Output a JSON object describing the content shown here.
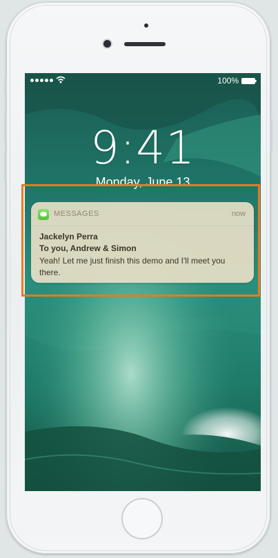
{
  "status_bar": {
    "signal_bars": 5,
    "battery_percent": "100%",
    "icons": [
      "signal-dots-icon",
      "wifi-icon",
      "battery-icon"
    ]
  },
  "lock_screen": {
    "time": "9:41",
    "date": "Monday, June 13"
  },
  "notification": {
    "app_name": "MESSAGES",
    "app_icon": "messages-icon",
    "time": "now",
    "sender": "Jackelyn Perra",
    "recipients": "To you, Andrew & Simon",
    "message": "Yeah! Let me just finish this demo and I'll meet you there."
  },
  "colors": {
    "highlight": "#ea7a1e",
    "notification_bg": "#e8dec5",
    "wallpaper_primary": "#1f7a6a"
  }
}
